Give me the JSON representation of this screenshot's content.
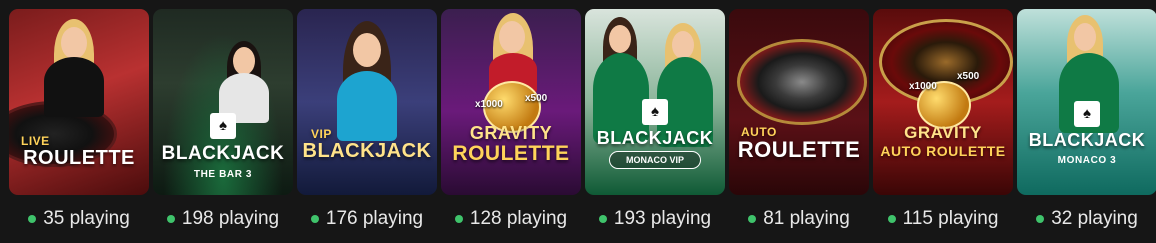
{
  "colors": {
    "background": "#161616",
    "status_dot": "#3fc36b",
    "count_text": "#e8e8e8"
  },
  "games": [
    {
      "logo_top": "LIVE",
      "logo_main": "ROULETTE",
      "players": "35 playing"
    },
    {
      "logo_top": "",
      "logo_main": "BLACKJACK",
      "logo_sub": "THE BAR 3",
      "players": "198 playing"
    },
    {
      "logo_top": "VIP",
      "logo_main": "BLACKJACK",
      "players": "176 playing"
    },
    {
      "logo_top": "GRAVITY",
      "logo_main": "ROULETTE",
      "mult_a": "x1000",
      "mult_b": "x500",
      "players": "128 playing"
    },
    {
      "logo_main": "BLACKJACK",
      "logo_sub": "MONACO VIP",
      "players": "193 playing"
    },
    {
      "logo_top": "AUTO",
      "logo_main": "ROULETTE",
      "players": "81 playing"
    },
    {
      "logo_top": "GRAVITY",
      "logo_main": "AUTO ROULETTE",
      "mult_a": "x1000",
      "mult_b": "x500",
      "players": "115 playing"
    },
    {
      "logo_main": "BLACKJACK",
      "logo_sub": "MONACO 3",
      "players": "32 playing"
    }
  ]
}
